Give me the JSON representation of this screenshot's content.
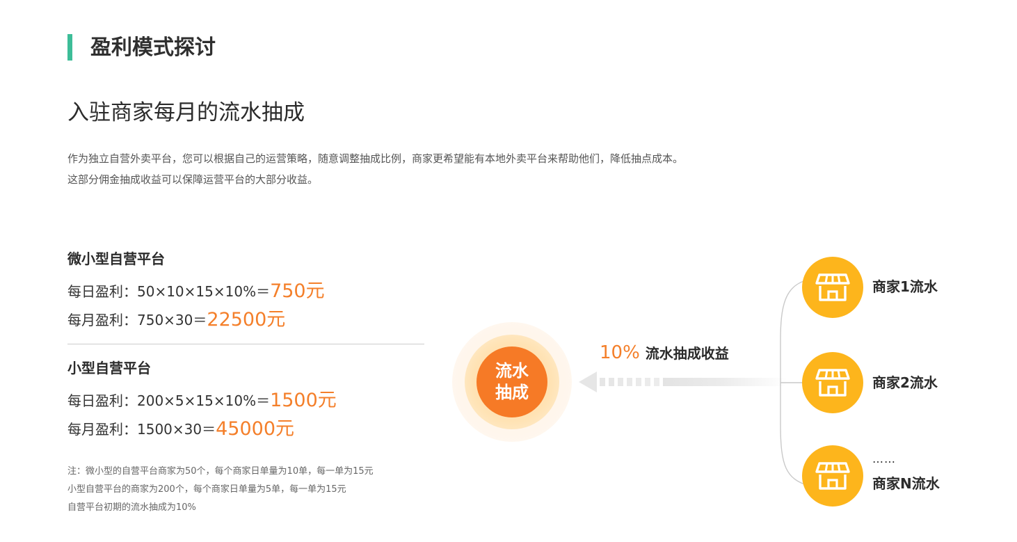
{
  "header": {
    "title": "盈利模式探讨"
  },
  "subtitle": "入驻商家每月的流水抽成",
  "intro": [
    "作为独立自营外卖平台，您可以根据自己的运营策略，随意调整抽成比例，商家更希望能有本地外卖平台来帮助他们，降低抽点成本。",
    "这部分佣金抽成收益可以保障运营平台的大部分收益。"
  ],
  "plans": [
    {
      "title": "微小型自营平台",
      "daily": {
        "label": "每日盈利：",
        "formula": "50×10×15×10%＝",
        "result": "750元"
      },
      "monthly": {
        "label": "每月盈利：",
        "formula": "750×30＝",
        "result": "22500元"
      }
    },
    {
      "title": "小型自营平台",
      "daily": {
        "label": "每日盈利：",
        "formula": "200×5×15×10%＝",
        "result": "1500元"
      },
      "monthly": {
        "label": "每月盈利：",
        "formula": "1500×30＝",
        "result": "45000元"
      }
    }
  ],
  "notes": [
    "注：微小型的自营平台商家为50个，每个商家日单量为10单，每一单为15元",
    "小型自营平台的商家为200个，每个商家日单量为5单，每一单为15元",
    "自营平台初期的流水抽成为10%"
  ],
  "diagram": {
    "center": {
      "line1": "流水",
      "line2": "抽成"
    },
    "flow": {
      "percent": "10%",
      "text": "流水抽成收益"
    },
    "merchants": [
      {
        "label": "商家1流水",
        "icon": "store-icon"
      },
      {
        "label": "商家2流水",
        "icon": "store-icon"
      },
      {
        "label": "商家N流水",
        "icon": "store-icon"
      }
    ],
    "ellipsis": "……"
  },
  "colors": {
    "accent_green": "#3dbd98",
    "accent_orange": "#f47f2a",
    "merchant_yellow": "#fdb51c"
  }
}
